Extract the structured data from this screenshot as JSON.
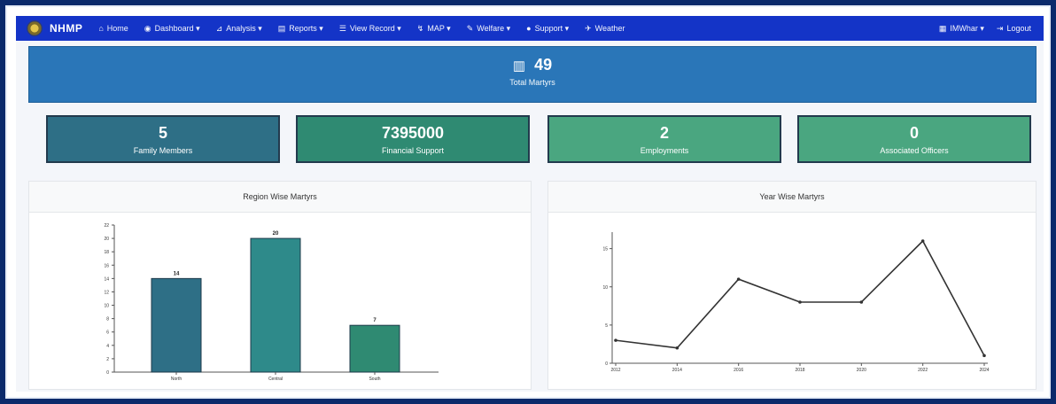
{
  "nav": {
    "brand": "NHMP",
    "items": [
      {
        "icon": "⌂",
        "label": "Home"
      },
      {
        "icon": "◉",
        "label": "Dashboard ▾"
      },
      {
        "icon": "⊿",
        "label": "Analysis ▾"
      },
      {
        "icon": "▤",
        "label": "Reports ▾"
      },
      {
        "icon": "☰",
        "label": "View Record ▾"
      },
      {
        "icon": "↯",
        "label": "MAP ▾"
      },
      {
        "icon": "✎",
        "label": "Welfare ▾"
      },
      {
        "icon": "●",
        "label": "Support ▾"
      },
      {
        "icon": "✈",
        "label": "Weather"
      }
    ],
    "right": [
      {
        "icon": "▦",
        "label": "IMWhar ▾"
      },
      {
        "icon": "⇥",
        "label": "Logout"
      }
    ]
  },
  "total": {
    "value": "49",
    "label": "Total Martyrs"
  },
  "stats": [
    {
      "value": "5",
      "label": "Family Members",
      "color": "#2e6f86"
    },
    {
      "value": "7395000",
      "label": "Financial Support",
      "color": "#2f8a72"
    },
    {
      "value": "2",
      "label": "Employments",
      "color": "#4aa680"
    },
    {
      "value": "0",
      "label": "Associated Officers",
      "color": "#4aa680"
    }
  ],
  "charts": {
    "region_title": "Region Wise Martyrs",
    "year_title": "Year Wise Martyrs"
  },
  "chart_data": [
    {
      "type": "bar",
      "title": "Region Wise Martyrs",
      "categories": [
        "North",
        "Central",
        "South"
      ],
      "values": [
        14,
        20,
        7
      ],
      "data_labels": [
        "14",
        "20",
        "7"
      ],
      "colors": [
        "#2e6f86",
        "#2e8a8a",
        "#2f8a72"
      ],
      "ylim": [
        0,
        22
      ],
      "yticks": [
        0,
        2,
        4,
        6,
        8,
        10,
        12,
        14,
        16,
        18,
        20,
        22
      ]
    },
    {
      "type": "line",
      "title": "Year Wise Martyrs",
      "x": [
        "2012",
        "2014",
        "2016",
        "2018",
        "2020",
        "2022",
        "2024"
      ],
      "values": [
        3,
        2,
        11,
        8,
        8,
        16,
        1
      ],
      "ylim": [
        0,
        16
      ],
      "yticks": [
        0,
        5,
        10,
        15
      ],
      "color": "#333333"
    }
  ]
}
